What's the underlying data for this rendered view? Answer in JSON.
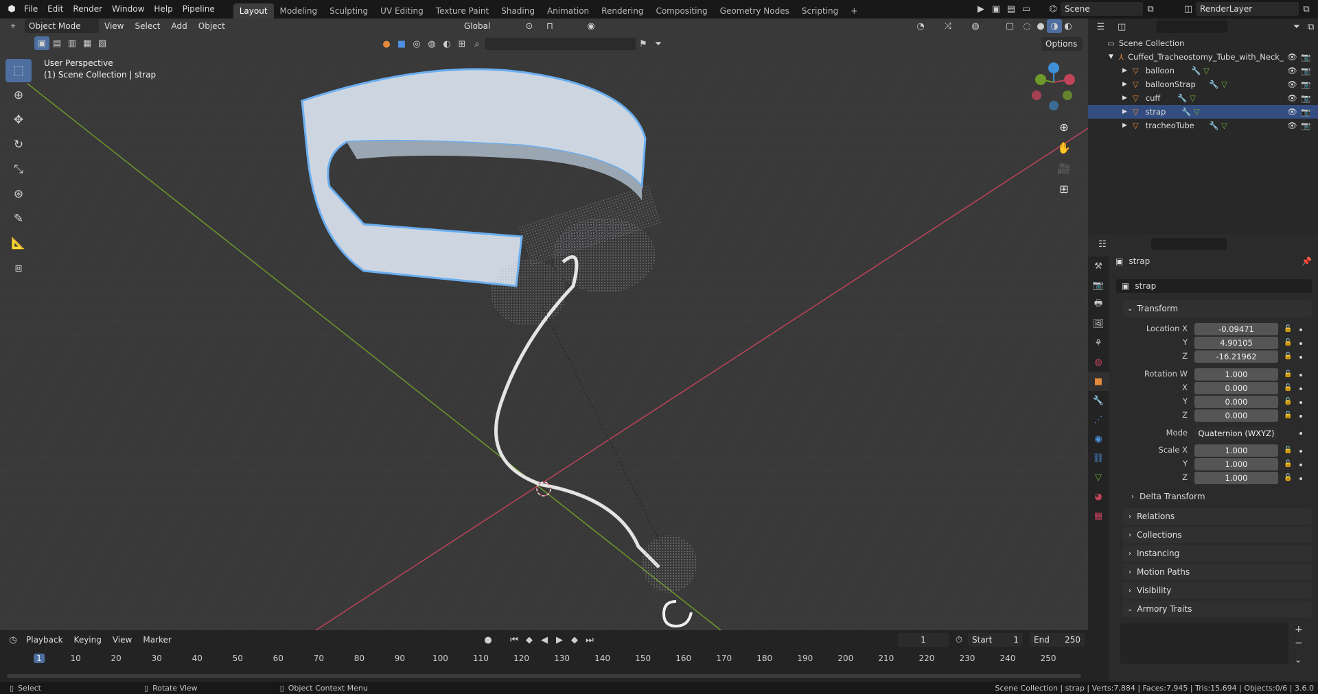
{
  "app": {
    "menus": [
      "File",
      "Edit",
      "Render",
      "Window",
      "Help",
      "Pipeline"
    ],
    "workspaces": [
      "Layout",
      "Modeling",
      "Sculpting",
      "UV Editing",
      "Texture Paint",
      "Shading",
      "Animation",
      "Rendering",
      "Compositing",
      "Geometry Nodes",
      "Scripting"
    ],
    "active_workspace": "Layout",
    "scene_name": "Scene",
    "view_layer": "RenderLayer"
  },
  "viewport": {
    "mode": "Object Mode",
    "menus": [
      "View",
      "Select",
      "Add",
      "Object"
    ],
    "transform_orientation": "Global",
    "options_label": "Options",
    "overlay_title": "User Perspective",
    "overlay_subtitle": "(1) Scene Collection | strap"
  },
  "outliner": {
    "root": "Scene Collection",
    "collection": "Cuffed_Tracheostomy_Tube_with_Neck_",
    "items": [
      {
        "name": "balloon"
      },
      {
        "name": "balloonStrap"
      },
      {
        "name": "cuff"
      },
      {
        "name": "strap"
      },
      {
        "name": "tracheoTube"
      }
    ]
  },
  "properties": {
    "object_name": "strap",
    "data_name": "strap",
    "transform_label": "Transform",
    "location_label": "Location X",
    "location": {
      "x": "-0.09471",
      "y": "4.90105",
      "z": "-16.21962"
    },
    "rotation_label": "Rotation W",
    "rotation": {
      "w": "1.000",
      "x": "0.000",
      "y": "0.000",
      "z": "0.000"
    },
    "mode_label": "Mode",
    "mode_value": "Quaternion (WXYZ)",
    "scale_label": "Scale X",
    "scale": {
      "x": "1.000",
      "y": "1.000",
      "z": "1.000"
    },
    "axis_labels": {
      "x": "X",
      "y": "Y",
      "z": "Z"
    },
    "panels": [
      "Delta Transform",
      "Relations",
      "Collections",
      "Instancing",
      "Motion Paths",
      "Visibility",
      "Armory Traits"
    ]
  },
  "timeline": {
    "menus": [
      "Playback",
      "Keying",
      "View",
      "Marker"
    ],
    "current_frame": "1",
    "start_label": "Start",
    "start_value": "1",
    "end_label": "End",
    "end_value": "250",
    "ticks": [
      "1",
      "10",
      "20",
      "30",
      "40",
      "50",
      "60",
      "70",
      "80",
      "90",
      "100",
      "110",
      "120",
      "130",
      "140",
      "150",
      "160",
      "170",
      "180",
      "190",
      "200",
      "210",
      "220",
      "230",
      "240",
      "250"
    ]
  },
  "status": {
    "select": "Select",
    "rotate": "Rotate View",
    "context": "Object Context Menu",
    "stats": "Scene Collection | strap | Verts:7,884 | Faces:7,945 | Tris:15,694 | Objects:0/6 | 3.6.0"
  },
  "colors": {
    "accent": "#4d6e9f",
    "axis_x": "#c0435a",
    "axis_y": "#6e9a2b",
    "axis_z": "#3f8fd6",
    "object_orange": "#e48a3d"
  }
}
